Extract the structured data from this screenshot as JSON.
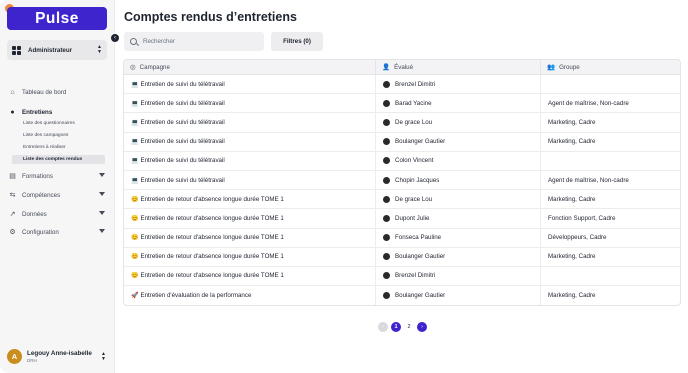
{
  "app": {
    "logo": "Pulse"
  },
  "sidebar": {
    "role": "Administrateur",
    "nav": [
      {
        "label": "Tableau de bord",
        "icon": "house-icon"
      },
      {
        "label": "Entretiens",
        "icon": "chat-bubble-icon"
      },
      {
        "label": "Formations",
        "icon": "box-icon"
      },
      {
        "label": "Compétences",
        "icon": "sliders-icon"
      },
      {
        "label": "Données",
        "icon": "chart-line-icon"
      },
      {
        "label": "Configuration",
        "icon": "gear-icon"
      }
    ],
    "subnav": [
      {
        "label": "Liste des questionnaires"
      },
      {
        "label": "Liste des campagnes"
      },
      {
        "label": "Entretiens à réaliser"
      },
      {
        "label": "Liste des comptes rendus"
      }
    ],
    "user": {
      "initial": "A",
      "name": "Legouy Anne-isabelle",
      "role": "DRH"
    }
  },
  "main": {
    "title": "Comptes rendus d’entretiens",
    "search_placeholder": "Rechercher",
    "filters_label": "Filtres (0)",
    "columns": [
      "Campagne",
      "Évalué",
      "Groupe"
    ],
    "rows": [
      {
        "emoji": "💻",
        "campaign": "Entretien de suivi du télétravail",
        "person": "Brenzel Dimitri",
        "group": ""
      },
      {
        "emoji": "💻",
        "campaign": "Entretien de suivi du télétravail",
        "person": "Barad Yacine",
        "group": "Agent de maîtrise, Non-cadre"
      },
      {
        "emoji": "💻",
        "campaign": "Entretien de suivi du télétravail",
        "person": "De grace Lou",
        "group": "Marketing, Cadre"
      },
      {
        "emoji": "💻",
        "campaign": "Entretien de suivi du télétravail",
        "person": "Boulanger Gautier",
        "group": "Marketing, Cadre"
      },
      {
        "emoji": "💻",
        "campaign": "Entretien de suivi du télétravail",
        "person": "Colon Vincent",
        "group": ""
      },
      {
        "emoji": "💻",
        "campaign": "Entretien de suivi du télétravail",
        "person": "Chopin Jacques",
        "group": "Agent de maîtrise, Non-cadre"
      },
      {
        "emoji": "😊",
        "campaign": "Entretien de retour d'absence longue durée TOME 1",
        "person": "De grace Lou",
        "group": "Marketing, Cadre"
      },
      {
        "emoji": "😊",
        "campaign": "Entretien de retour d'absence longue durée TOME 1",
        "person": "Dupont Julie",
        "group": "Fonction Support, Cadre"
      },
      {
        "emoji": "😊",
        "campaign": "Entretien de retour d'absence longue durée TOME 1",
        "person": "Fonseca Pauline",
        "group": "Développeurs, Cadre"
      },
      {
        "emoji": "😊",
        "campaign": "Entretien de retour d'absence longue durée TOME 1",
        "person": "Boulanger Gautier",
        "group": "Marketing, Cadre"
      },
      {
        "emoji": "😊",
        "campaign": "Entretien de retour d'absence longue durée TOME 1",
        "person": "Brenzel Dimitri",
        "group": ""
      },
      {
        "emoji": "🚀",
        "campaign": "Entretien d'évaluation de la performance",
        "person": "Boulanger Gautier",
        "group": "Marketing, Cadre"
      }
    ],
    "pagination": {
      "prev": "‹",
      "pages": [
        "1",
        "2"
      ],
      "current": "1",
      "next": "›"
    }
  },
  "colors": {
    "accent": "#3d24cc",
    "avatar": "#c98e1d"
  }
}
